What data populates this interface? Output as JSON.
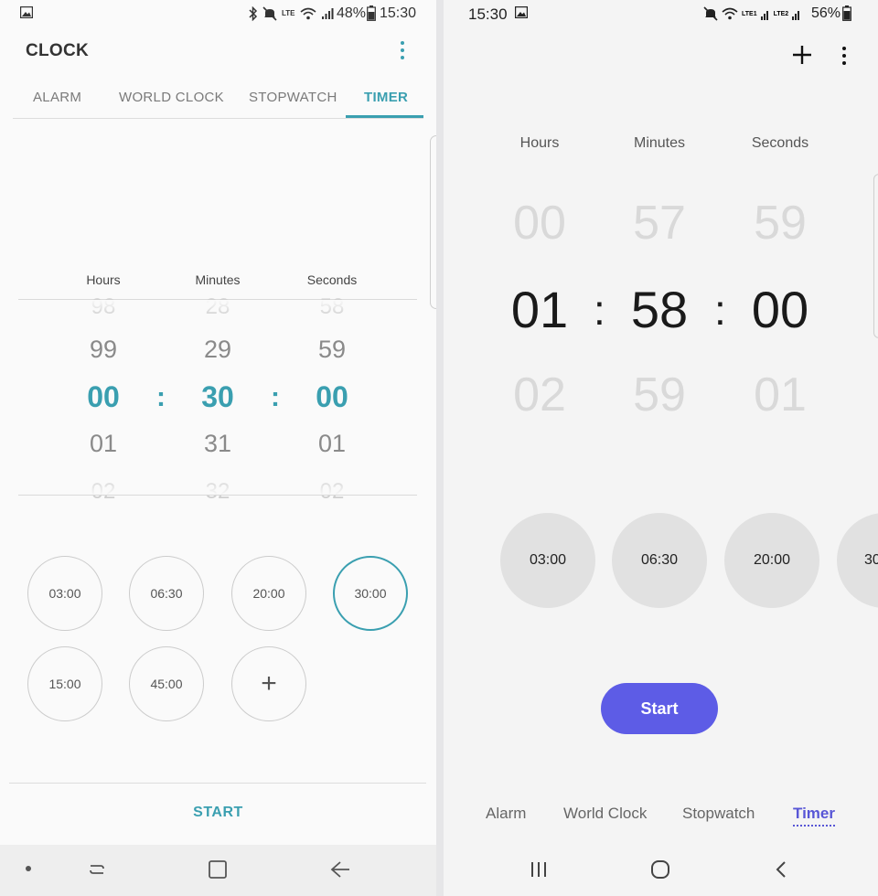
{
  "left": {
    "status": {
      "battery": "48%",
      "time": "15:30",
      "network": "LTE"
    },
    "app_title": "CLOCK",
    "tabs": [
      {
        "label": "ALARM"
      },
      {
        "label": "WORLD CLOCK"
      },
      {
        "label": "STOPWATCH"
      },
      {
        "label": "TIMER",
        "active": true
      }
    ],
    "columns": [
      "Hours",
      "Minutes",
      "Seconds"
    ],
    "picker": {
      "hours": [
        "98",
        "99",
        "00",
        "01",
        "02"
      ],
      "minutes": [
        "28",
        "29",
        "30",
        "31",
        "32"
      ],
      "seconds": [
        "58",
        "59",
        "00",
        "01",
        "02"
      ],
      "separator": ":"
    },
    "presets": [
      "03:00",
      "06:30",
      "20:00",
      "30:00",
      "15:00",
      "45:00"
    ],
    "selected_preset": "30:00",
    "add_preset_label": "+",
    "start_label": "START",
    "accent": "#3a9fb0"
  },
  "right": {
    "status": {
      "time": "15:30",
      "battery": "56%",
      "network1": "LTE1",
      "network2": "LTE2"
    },
    "columns": [
      "Hours",
      "Minutes",
      "Seconds"
    ],
    "picker": {
      "hours": [
        "00",
        "01",
        "02"
      ],
      "minutes": [
        "57",
        "58",
        "59"
      ],
      "seconds": [
        "59",
        "00",
        "01"
      ],
      "separator": ":"
    },
    "presets": [
      "03:00",
      "06:30",
      "20:00",
      "30"
    ],
    "start_label": "Start",
    "tabs": [
      {
        "label": "Alarm"
      },
      {
        "label": "World Clock"
      },
      {
        "label": "Stopwatch"
      },
      {
        "label": "Timer",
        "active": true
      }
    ],
    "accent": "#5d5ce6"
  }
}
